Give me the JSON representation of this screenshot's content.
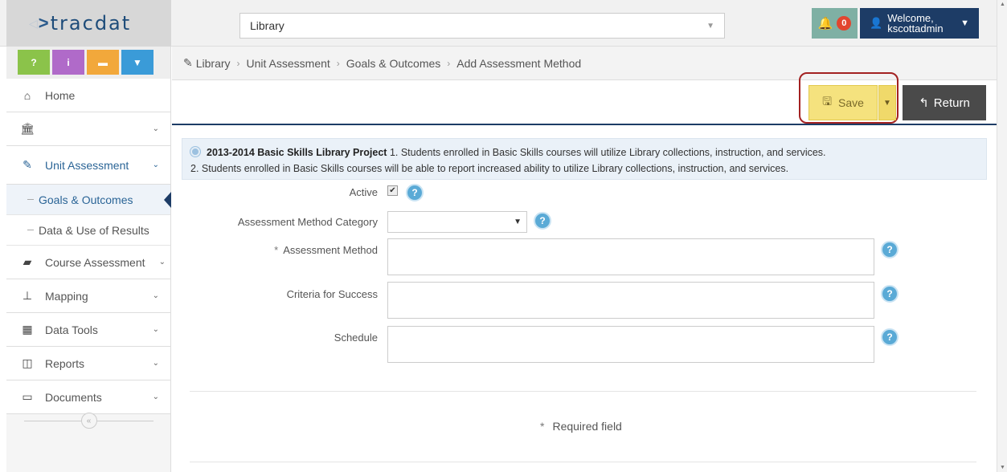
{
  "app": {
    "logo_text": "tracdat",
    "project": "Library",
    "notifications_count": "0",
    "welcome": "Welcome,",
    "username": "kscottadmin"
  },
  "quick_buttons": [
    {
      "label": "?",
      "color": "#8bc34a"
    },
    {
      "label": "i",
      "color": "#b06ac9"
    },
    {
      "label": "▬",
      "color": "#f2a83b"
    },
    {
      "label": "▼",
      "color": "#3a9bd8"
    }
  ],
  "sidebar": {
    "home": "Home",
    "units": "",
    "unit_assessment": "Unit Assessment",
    "goals_outcomes": "Goals & Outcomes",
    "data_use": "Data & Use of Results",
    "course_assessment": "Course Assessment",
    "mapping": "Mapping",
    "data_tools": "Data Tools",
    "reports": "Reports",
    "documents": "Documents"
  },
  "breadcrumb": [
    "Library",
    "Unit Assessment",
    "Goals & Outcomes",
    "Add Assessment Method"
  ],
  "toolbar": {
    "save": "Save",
    "return": "Return"
  },
  "goal": {
    "title": "2013-2014 Basic Skills Library Project",
    "line1": "1. Students enrolled in Basic Skills courses will utilize Library collections, instruction, and services.",
    "line2": "2. Students enrolled in Basic Skills courses will be able to report increased ability to utilize Library collections, instruction, and services."
  },
  "form": {
    "active_label": "Active",
    "category_label": "Assessment Method Category",
    "method_label": "Assessment Method",
    "criteria_label": "Criteria for Success",
    "schedule_label": "Schedule",
    "required_note": "Required field"
  }
}
